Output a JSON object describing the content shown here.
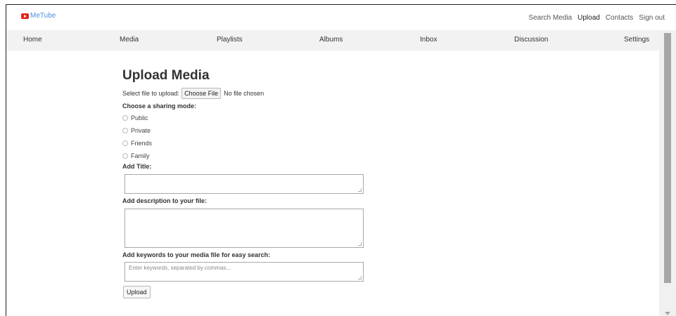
{
  "brand": {
    "name": "MeTube",
    "color": "#e62117"
  },
  "top_links": [
    "Search Media",
    "Upload",
    "Contacts",
    "Sign out"
  ],
  "menu": [
    "Home",
    "Media",
    "Playlists",
    "Albums",
    "Inbox",
    "Discussion",
    "Settings"
  ],
  "page": {
    "title": "Upload Media",
    "file_label": "Select file to upload:",
    "file_button": "Choose File",
    "file_status": "No file chosen",
    "sharing_label": "Choose a sharing mode:",
    "sharing_options": [
      "Public",
      "Private",
      "Friends",
      "Family"
    ],
    "title_label": "Add Title:",
    "title_value": "",
    "description_label": "Add description to your file:",
    "description_value": "",
    "keywords_label": "Add keywords to your media file for easy search:",
    "keywords_placeholder": "Enter keywords, separated by commas...",
    "upload_button": "Upload"
  }
}
